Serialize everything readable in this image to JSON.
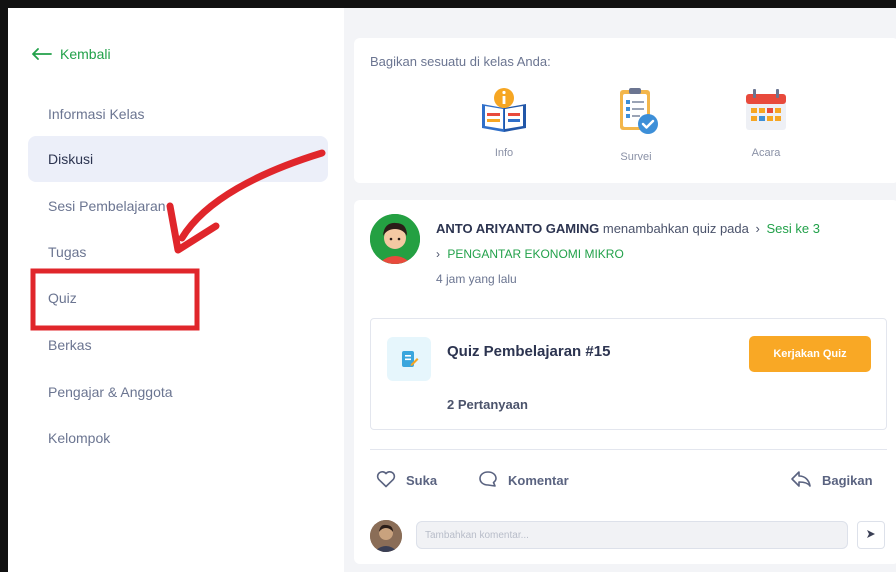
{
  "sidebar": {
    "back_label": "Kembali",
    "items": [
      {
        "label": "Informasi Kelas"
      },
      {
        "label": "Diskusi"
      },
      {
        "label": "Sesi Pembelajaran"
      },
      {
        "label": "Tugas"
      },
      {
        "label": "Quiz"
      },
      {
        "label": "Berkas"
      },
      {
        "label": "Pengajar & Anggota"
      },
      {
        "label": "Kelompok"
      }
    ],
    "active_item": "Diskusi"
  },
  "share": {
    "title": "Bagikan sesuatu di kelas Anda:",
    "options": [
      {
        "label": "Info",
        "icon": "book-info-icon"
      },
      {
        "label": "Survei",
        "icon": "survey-clipboard-icon"
      },
      {
        "label": "Acara",
        "icon": "calendar-icon"
      }
    ]
  },
  "post": {
    "author": "ANTO ARIYANTO GAMING",
    "action": "menambahkan quiz pada",
    "session": "Sesi ke 3",
    "topic": "PENGANTAR EKONOMI MIKRO",
    "time": "4 jam yang lalu",
    "quiz": {
      "title": "Quiz Pembelajaran #15",
      "button_label": "Kerjakan Quiz",
      "questions": "2 Pertanyaan"
    },
    "actions": {
      "like": "Suka",
      "comment": "Komentar",
      "share": "Bagikan"
    },
    "comment_placeholder": "Tambahkan komentar..."
  },
  "colors": {
    "accent_green": "#22a14a",
    "quiz_button": "#f9a825",
    "annotation_red": "#e0262b",
    "active_nav_bg": "#eceff9"
  }
}
